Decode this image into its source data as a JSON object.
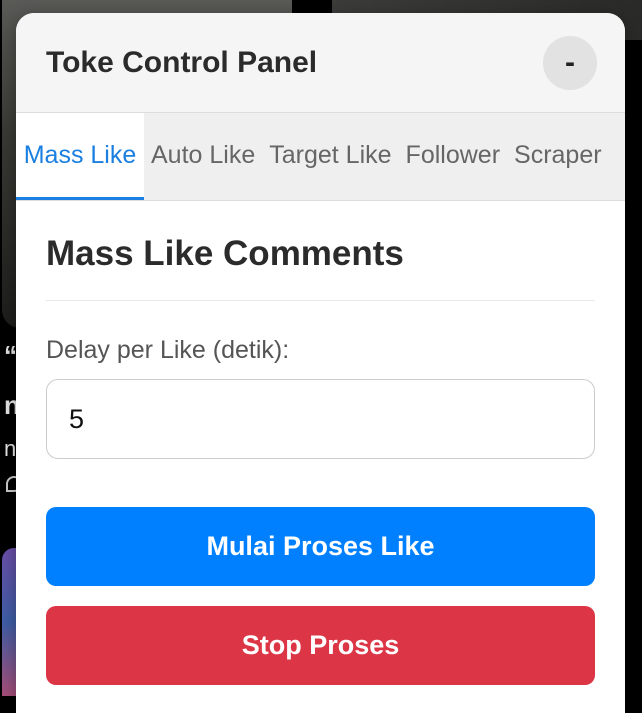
{
  "panel": {
    "title": "Toke Control Panel",
    "minimize_label": "-"
  },
  "tabs": [
    {
      "label": "Mass Like",
      "active": true
    },
    {
      "label": "Auto Like",
      "active": false
    },
    {
      "label": "Target Like",
      "active": false
    },
    {
      "label": "Follower",
      "active": false
    },
    {
      "label": "Scraper",
      "active": false
    }
  ],
  "section": {
    "title": "Mass Like Comments",
    "delay_label": "Delay per Like (detik):",
    "delay_value": "5"
  },
  "buttons": {
    "start_label": "Mulai Proses Like",
    "stop_label": "Stop Proses"
  },
  "background": {
    "text_1": "“",
    "text_2": "n",
    "text_3": "n"
  },
  "colors": {
    "accent": "#1a7fe0",
    "start_button": "#0080ff",
    "stop_button": "#dc3545"
  }
}
